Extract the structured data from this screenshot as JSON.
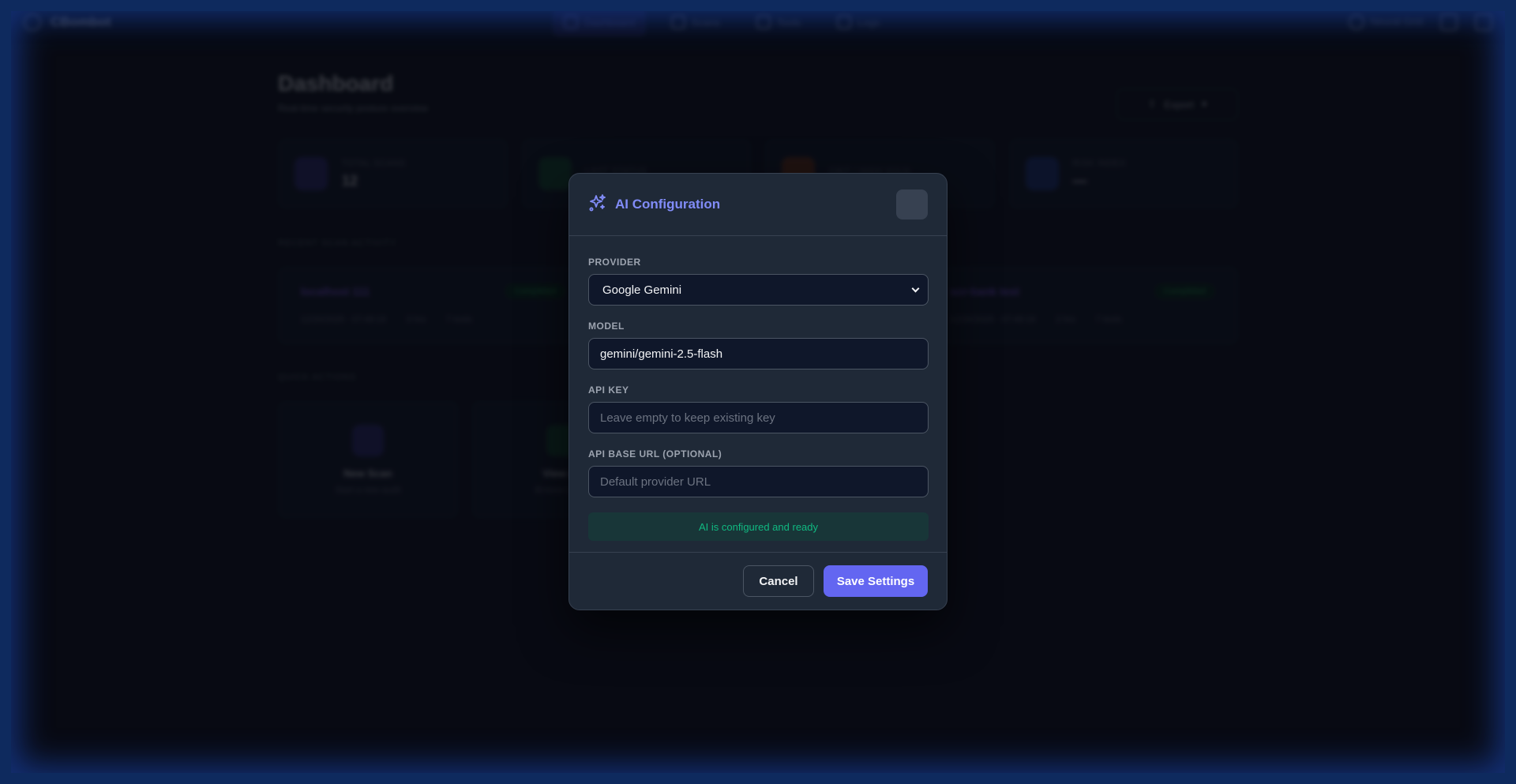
{
  "nav": {
    "brand": "CBombot",
    "links": [
      {
        "label": "Dashboard",
        "active": true
      },
      {
        "label": "Scans",
        "active": false
      },
      {
        "label": "Tools",
        "active": false
      },
      {
        "label": "Logs",
        "active": false
      }
    ],
    "right_label": "Neural Grid"
  },
  "dashboard": {
    "title": "Dashboard",
    "subtitle": "Real-time security posture overview",
    "export_label": "Export",
    "stats": [
      {
        "label": "Total Scans",
        "value": "12",
        "color": "#4f46e5"
      },
      {
        "label": "Last Status",
        "value": "",
        "color": "#16a34a"
      },
      {
        "label": "Crit / High Vuln",
        "value": "",
        "color": "#f59e0b"
      },
      {
        "label": "Risk Index",
        "value": "—",
        "color": "#2563eb"
      }
    ],
    "activity_heading": "Recent Scan Activity",
    "activity": [
      {
        "title": "localhost 111",
        "badge": "Completed",
        "meta": [
          "12/20/2025 · 07:48:19",
          "3 hrs",
          "7 tools"
        ]
      },
      {
        "title": "",
        "badge": "",
        "meta": []
      },
      {
        "title": "scr-bank test",
        "badge": "Completed",
        "meta": [
          "12/20/2025 · 07:48:19",
          "2 hrs",
          "7 tools"
        ]
      }
    ],
    "actions_heading": "Quick Actions",
    "actions": [
      {
        "title": "New Scan",
        "sub": "Start a new audit",
        "color": "#4f46e5"
      },
      {
        "title": "View All",
        "sub": "Browse scans",
        "color": "#16a34a"
      }
    ]
  },
  "modal": {
    "title": "AI Configuration",
    "icon": "sparkles-icon",
    "provider": {
      "label": "Provider",
      "value": "Google Gemini"
    },
    "model": {
      "label": "Model",
      "value": "gemini/gemini-2.5-flash"
    },
    "api_key": {
      "label": "API Key",
      "placeholder": "Leave empty to keep existing key"
    },
    "base_url": {
      "label": "API Base URL (Optional)",
      "placeholder": "Default provider URL"
    },
    "status": "AI is configured and ready",
    "cancel_label": "Cancel",
    "save_label": "Save Settings",
    "accent": "#6366f1",
    "status_color": "#10b981"
  }
}
